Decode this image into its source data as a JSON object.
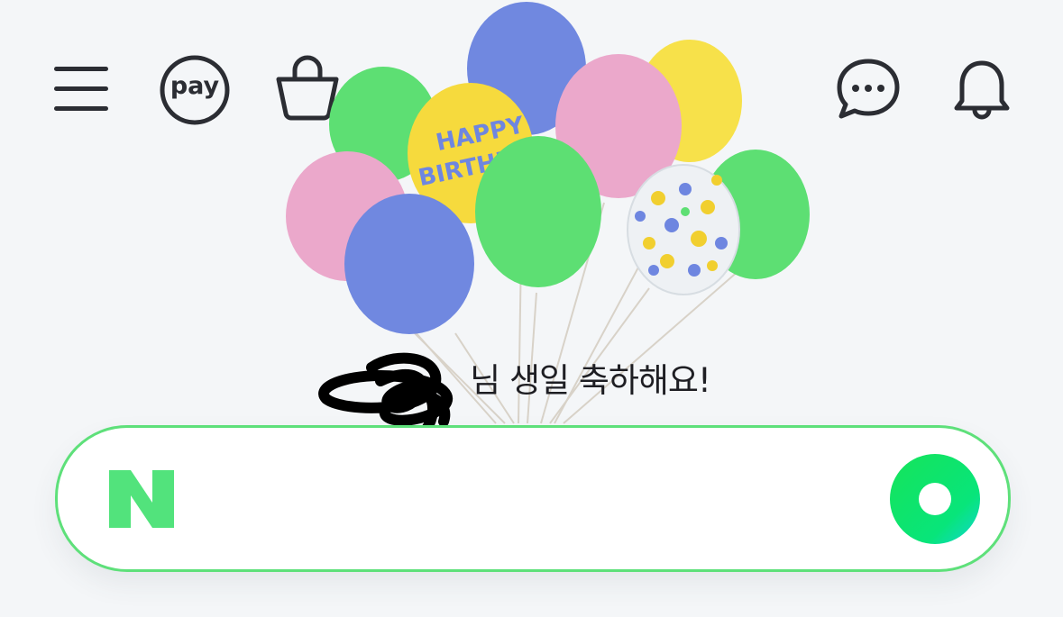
{
  "header": {
    "menu_icon": "hamburger-menu-icon",
    "pay_label": "pay",
    "cart_icon": "shopping-bag-icon",
    "chat_icon": "chat-bubble-icon",
    "notification_icon": "bell-icon"
  },
  "banner": {
    "balloon_text_1": "HAPPY",
    "balloon_text_2": "BIRTHDAY",
    "greeting_suffix": "님 생일 축하해요!"
  },
  "search": {
    "logo_letter": "N",
    "placeholder": "",
    "value": "",
    "action_icon": "green-ring-button-icon"
  },
  "colors": {
    "accent_green": "#5ee07a",
    "logo_green": "#52e37c",
    "background": "#f4f6f8",
    "icon_dark": "#2b2d33"
  }
}
